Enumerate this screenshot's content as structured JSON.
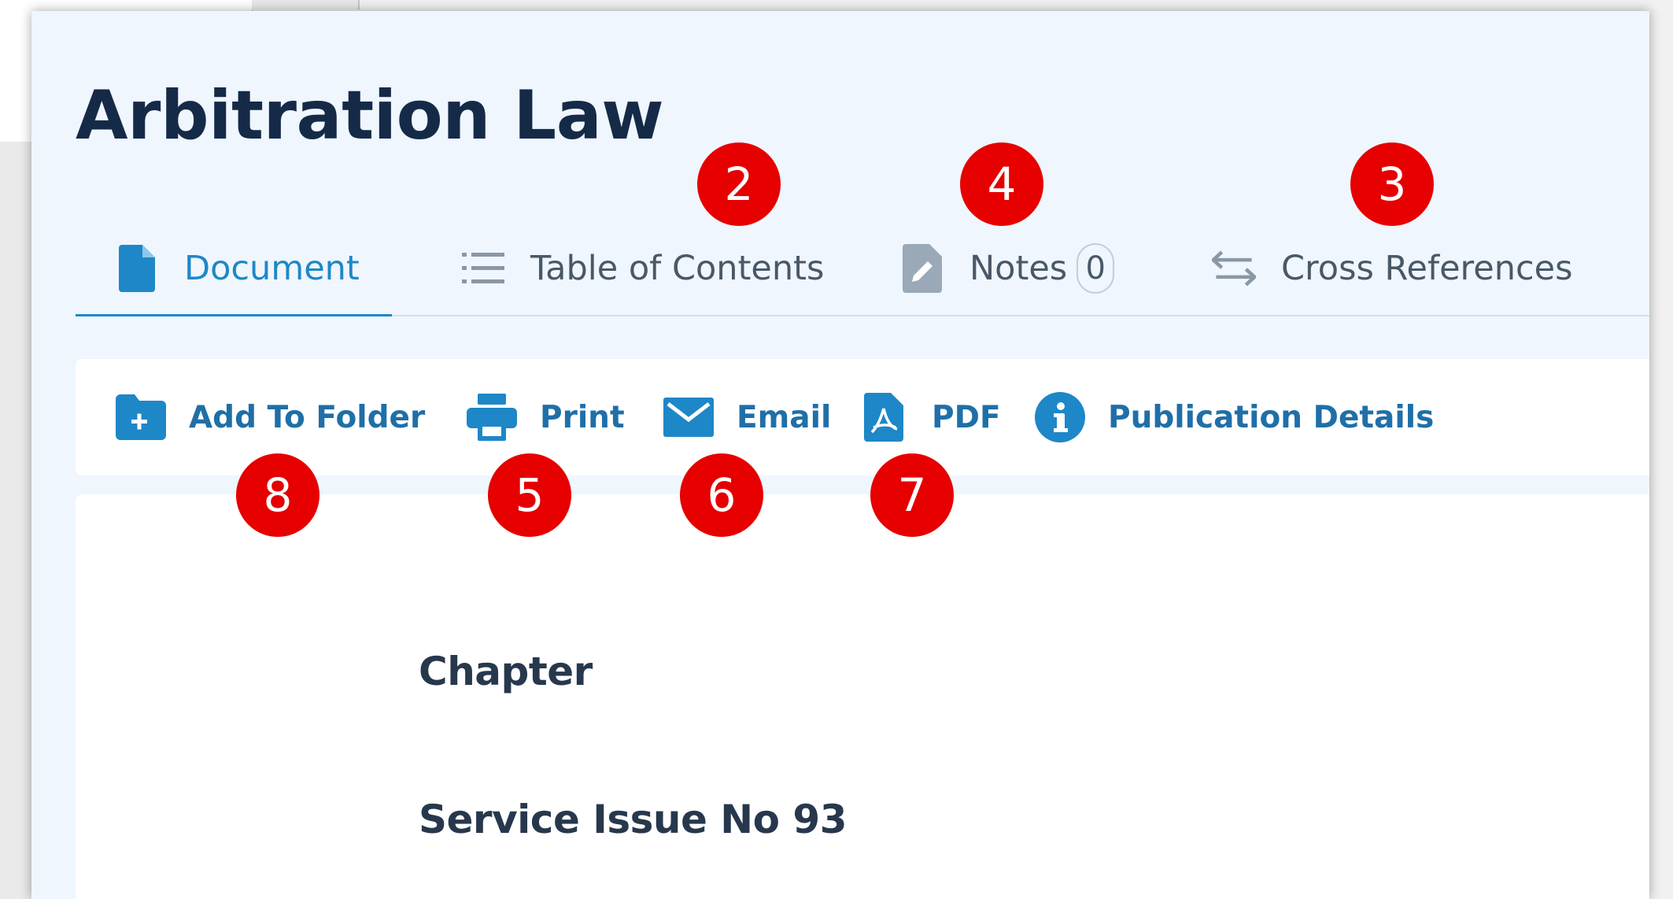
{
  "page": {
    "title": "Arbitration Law"
  },
  "tabs": [
    {
      "label": "Document",
      "icon": "document-icon",
      "active": true
    },
    {
      "label": "Table of Contents",
      "icon": "list-icon",
      "active": false
    },
    {
      "label": "Notes",
      "icon": "note-edit-icon",
      "active": false,
      "count": "0"
    },
    {
      "label": "Cross References",
      "icon": "arrows-swap-icon",
      "active": false
    }
  ],
  "toolbar": {
    "add_to_folder": {
      "label": "Add To Folder",
      "icon": "folder-add-icon"
    },
    "print": {
      "label": "Print",
      "icon": "printer-icon"
    },
    "email": {
      "label": "Email",
      "icon": "envelope-icon"
    },
    "pdf": {
      "label": "PDF",
      "icon": "pdf-file-icon"
    },
    "publication_details": {
      "label": "Publication Details",
      "icon": "info-icon"
    }
  },
  "content": {
    "chapter": "Chapter",
    "service_issue": "Service Issue No 93"
  },
  "markers": [
    "2",
    "4",
    "3",
    "8",
    "5",
    "6",
    "7"
  ],
  "colors": {
    "accent": "#1e87c8",
    "toolbar_text": "#1f6fa8",
    "title_text": "#152a47",
    "marker": "#e60000",
    "window_bg": "#eff6fd"
  }
}
